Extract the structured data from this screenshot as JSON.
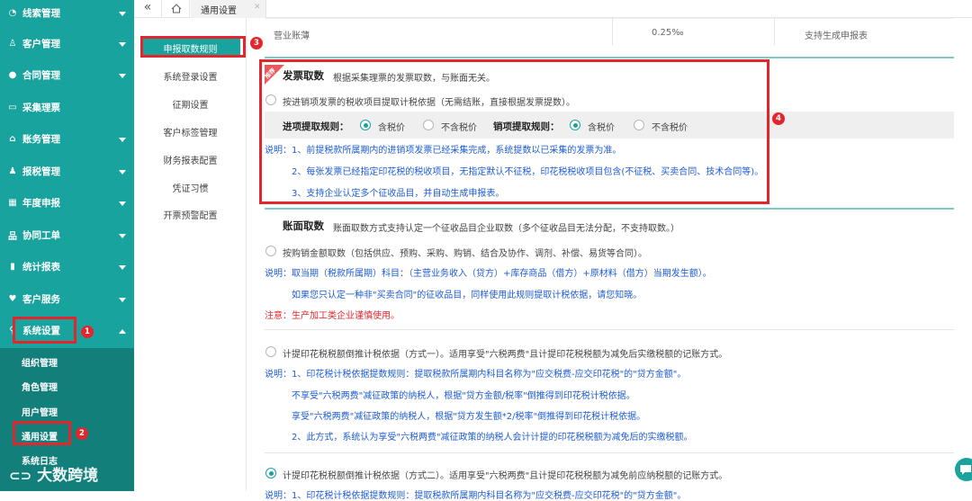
{
  "sidebar": {
    "items": [
      {
        "label": "线索管理",
        "icon": "gauge-icon"
      },
      {
        "label": "客户管理",
        "icon": "users-icon"
      },
      {
        "label": "合同管理",
        "icon": "user-icon"
      },
      {
        "label": "采集理票",
        "icon": "card-icon"
      },
      {
        "label": "账务管理",
        "icon": "bank-icon"
      },
      {
        "label": "报税管理",
        "icon": "user-group-icon"
      },
      {
        "label": "年度申报",
        "icon": "calendar-icon"
      },
      {
        "label": "协同工单",
        "icon": "sitemap-icon"
      },
      {
        "label": "统计报表",
        "icon": "bar-chart-icon"
      },
      {
        "label": "客户服务",
        "icon": "heart-icon"
      },
      {
        "label": "系统设置",
        "icon": "wrench-icon"
      }
    ],
    "sub_items": [
      "组织管理",
      "角色管理",
      "用户管理",
      "通用设置",
      "系统日志"
    ]
  },
  "tabs": {
    "active": "通用设置"
  },
  "menu2": [
    "申报取数规则",
    "系统登录设置",
    "征期设置",
    "客户标签管理",
    "财务报表配置",
    "凭证习惯",
    "开票预警配置"
  ],
  "top_table": {
    "cells": [
      "营业账薄",
      "0.25‰",
      "支持生成申报表"
    ]
  },
  "invoice": {
    "tag": "推荐",
    "title": "发票取数",
    "desc": "根据采集理票的发票取数，与账面无关。",
    "option": "按进销项发票的税收项目提取计税依据（无需结账，直接根据发票提数）。",
    "in_rule_label": "进项提取规则：",
    "out_rule_label": "销项提取规则：",
    "tax_incl": "含税价",
    "tax_excl": "不含税价",
    "note_prefix": "说明：",
    "notes": [
      "1、前提税款所属期内的进销项发票已经采集完成，系统提数以已采集的发票为准。",
      "2、每张发票已经指定印花税的税收项目，无指定默认不征税，印花税税收项目包含(不征税、买卖合同、技术合同等)。",
      "3、支持企业认定多个征收品目，并自动生成申报表。"
    ]
  },
  "ledger": {
    "title": "账面取数",
    "desc": "账面取数方式支持认定一个征收品目企业取数（多个征收品目无法分配，不支持取数。）",
    "option": "按购销金额取数（包括供应、预购、采购、购销、结合及协作、调剂、补偿、易货等合同）。",
    "note1": "说明：取当期（税款所属期）科目：（主营业务收入（贷方）+库存商品（借方）+原材料（借方）当期发生额）。",
    "note2": "如果您只认定一种非\"买卖合同\"的征收品目，同样使用此规则提取计税依据，请您知晓。",
    "warn": "注意：生产加工类企业谨慎使用。"
  },
  "method1": {
    "option": "计提印花税税额倒推计税依据（方式一）。适用享受\"六税两费\"且计提印花税税额为减免后实缴税额的记账方式。",
    "note1": "说明：1、印花税计税依据提数规则：提取税款所属期内科目名称为\"应交税费-应交印花税\"的\"贷方金额\"。",
    "note2": "不享受\"六税两费\"减征政策的纳税人，根据\"贷方金额/税率\"倒推得到印花税计税依据。",
    "note3": "享受\"六税两费\"减征政策的纳税人，根据\"贷方发生额*2/税率\"倒推得到印花税计税依据。",
    "note4": "2、此方式，系统认为享受\"六税两费\"减征政策的纳税人会计计提的印花税税额为减免后的实缴税额。"
  },
  "method2": {
    "option": "计提印花税税额倒推计税依据（方式二）。适用享受\"六税两费\"且计提印花税税额为减免前应纳税额的记账方式。",
    "note_partial": "说明：1、印花税计税依据提数规则：提取税款所属期内科目名称为\"应交税费-应交印花税\"的\"贷方金额\"。"
  },
  "badges": [
    "1",
    "2",
    "3",
    "4"
  ],
  "watermark": "大数跨境",
  "colors": {
    "sidebar": "#18a39e",
    "submenu": "#127f7b",
    "highlight": "#e3262c",
    "accent": "#19a39e",
    "link": "#1e5cd6"
  }
}
